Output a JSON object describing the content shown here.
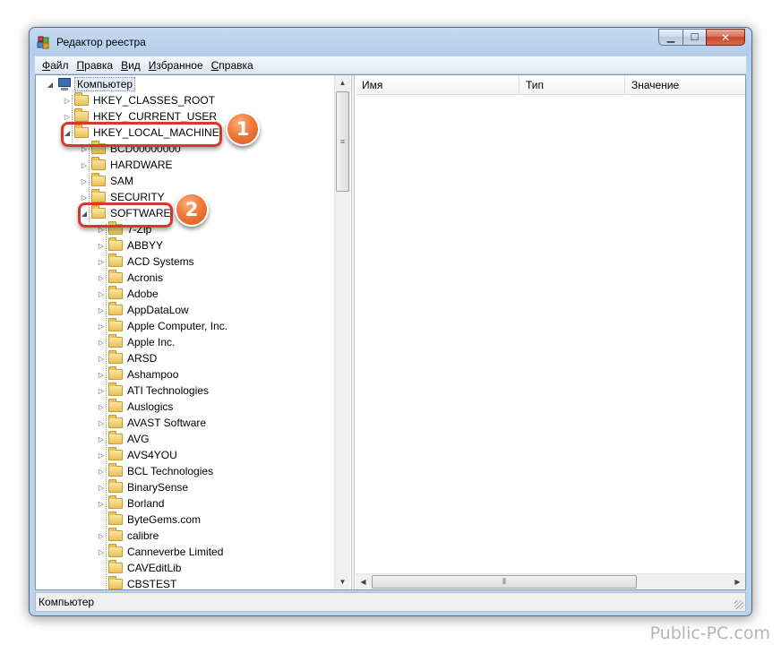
{
  "window": {
    "title": "Редактор реестра",
    "caption": {
      "minimize": "▁",
      "maximize": "☐",
      "close": "✕"
    }
  },
  "menu": [
    {
      "label": "Файл",
      "accel": "Ф",
      "rest": "айл"
    },
    {
      "label": "Правка",
      "accel": "П",
      "rest": "равка"
    },
    {
      "label": "Вид",
      "accel": "В",
      "rest": "ид"
    },
    {
      "label": "Избранное",
      "accel": "И",
      "rest": "збранное"
    },
    {
      "label": "Справка",
      "accel": "С",
      "rest": "правка"
    }
  ],
  "tree": {
    "root": "Компьютер",
    "hives": [
      "HKEY_CLASSES_ROOT",
      "HKEY_CURRENT_USER",
      "HKEY_LOCAL_MACHINE"
    ],
    "hklm_children": [
      "BCD00000000",
      "HARDWARE",
      "SAM",
      "SECURITY",
      "SOFTWARE"
    ],
    "software_children": [
      "7-Zip",
      "ABBYY",
      "ACD Systems",
      "Acronis",
      "Adobe",
      "AppDataLow",
      "Apple Computer, Inc.",
      "Apple Inc.",
      "ARSD",
      "Ashampoo",
      "ATI Technologies",
      "Auslogics",
      "AVAST Software",
      "AVG",
      "AVS4YOU",
      "BCL Technologies",
      "BinarySense",
      "Borland",
      "ByteGems.com",
      "calibre",
      "Canneverbe Limited",
      "CAVEditLib",
      "CBSTEST"
    ]
  },
  "list": {
    "columns": [
      "Имя",
      "Тип",
      "Значение"
    ]
  },
  "callouts": {
    "one": "1",
    "two": "2"
  },
  "status": "Компьютер",
  "watermark": "Public-PC.com",
  "colors": {
    "callout_border": "#d43a2c",
    "badge": "#f07a3a",
    "title_bar": "#bcd3ec"
  }
}
